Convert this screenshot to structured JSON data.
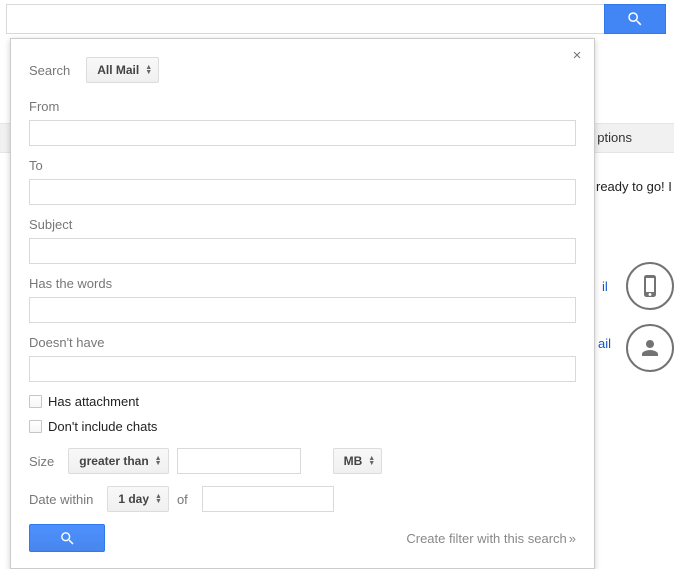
{
  "background": {
    "options_text": "ptions",
    "ready_text": "ready to go! I",
    "frag1": "il",
    "frag2": "ail"
  },
  "top_search": {
    "value": ""
  },
  "panel": {
    "close_symbol": "×",
    "search_label": "Search",
    "search_scope": {
      "selected": "All Mail"
    },
    "fields": {
      "from": {
        "label": "From",
        "value": ""
      },
      "to": {
        "label": "To",
        "value": ""
      },
      "subject": {
        "label": "Subject",
        "value": ""
      },
      "has_words": {
        "label": "Has the words",
        "value": ""
      },
      "doesnt_have": {
        "label": "Doesn't have",
        "value": ""
      }
    },
    "checkboxes": {
      "has_attachment": {
        "label": "Has attachment",
        "checked": false
      },
      "dont_include_chats": {
        "label": "Don't include chats",
        "checked": false
      }
    },
    "size": {
      "label": "Size",
      "comparator": "greater than",
      "value": "",
      "unit": "MB"
    },
    "date": {
      "label": "Date within",
      "within": "1 day",
      "of_label": "of",
      "of_value": ""
    },
    "filter_link": "Create filter with this search"
  }
}
